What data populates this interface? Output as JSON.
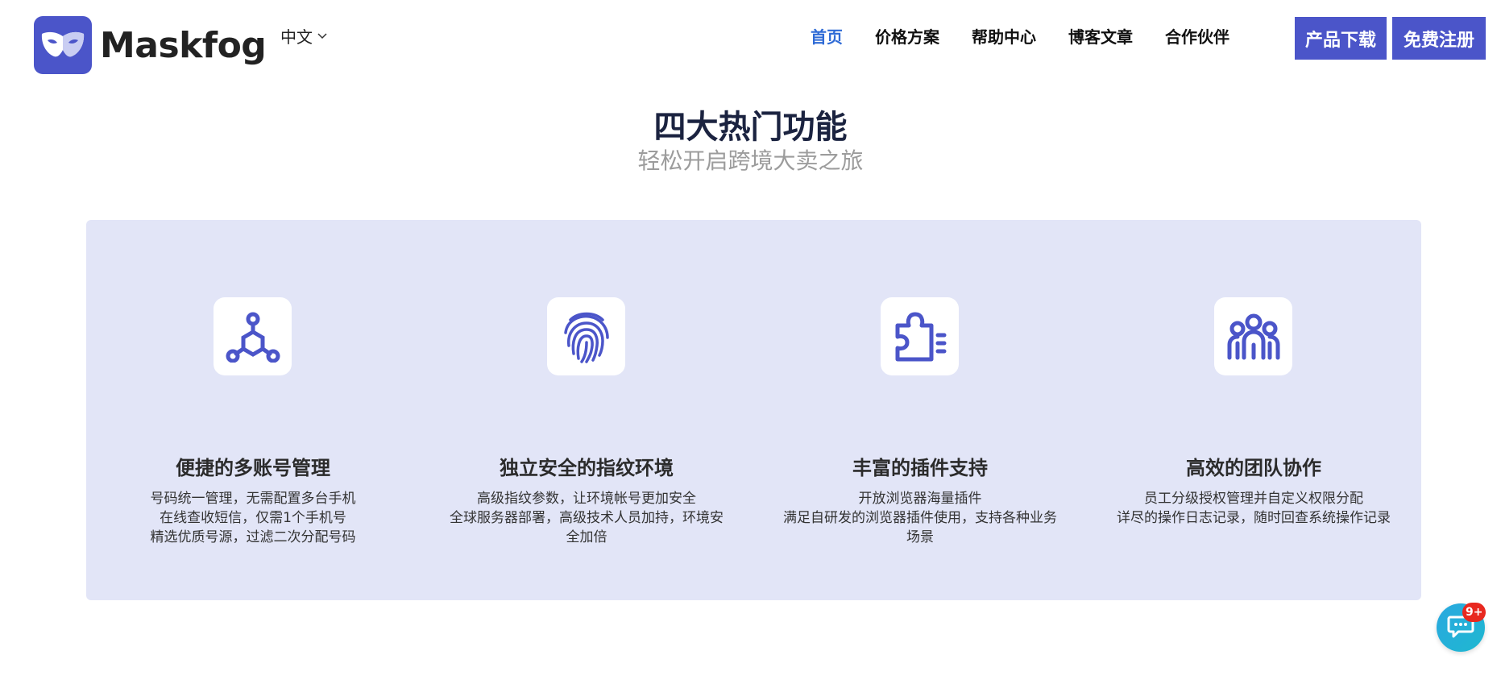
{
  "header": {
    "brand": "Maskfog",
    "language": "中文",
    "nav": [
      {
        "label": "首页",
        "active": true
      },
      {
        "label": "价格方案",
        "active": false
      },
      {
        "label": "帮助中心",
        "active": false
      },
      {
        "label": "博客文章",
        "active": false
      },
      {
        "label": "合作伙伴",
        "active": false
      }
    ],
    "download_label": "产品下载",
    "register_label": "免费注册"
  },
  "section": {
    "title": "四大热门功能",
    "subtitle": "轻松开启跨境大卖之旅"
  },
  "features": [
    {
      "icon": "network-nodes-icon",
      "title": "便捷的多账号管理",
      "lines": [
        "号码统一管理，无需配置多台手机",
        "在线查收短信，仅需1个手机号",
        "精选优质号源，过滤二次分配号码"
      ]
    },
    {
      "icon": "fingerprint-icon",
      "title": "独立安全的指纹环境",
      "lines": [
        "高级指纹参数，让环境帐号更加安全",
        "全球服务器部署，高级技术人员加持，环境安全加倍"
      ]
    },
    {
      "icon": "puzzle-plugin-icon",
      "title": "丰富的插件支持",
      "lines": [
        "开放浏览器海量插件",
        "满足自研发的浏览器插件使用，支持各种业务场景"
      ]
    },
    {
      "icon": "team-icon",
      "title": "高效的团队协作",
      "lines": [
        "员工分级授权管理并自定义权限分配",
        "详尽的操作日志记录，随时回查系统操作记录"
      ]
    }
  ],
  "chat": {
    "badge": "9+"
  },
  "colors": {
    "brand": "#4b55c9",
    "nav_active": "#2f6bd6",
    "panel_bg": "#e2e5f7",
    "icon_color": "#4b55c9",
    "badge": "#e8281f"
  }
}
